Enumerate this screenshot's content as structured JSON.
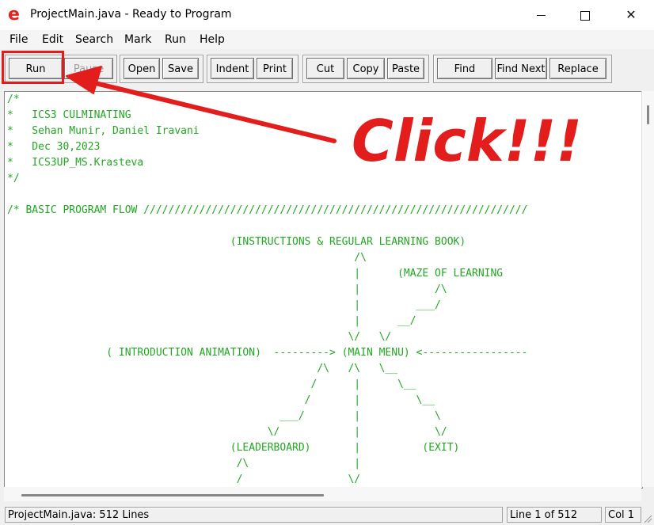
{
  "window": {
    "title": "ProjectMain.java - Ready to Program",
    "app_icon": "e",
    "controls": {
      "minimize": "minimize-icon",
      "maximize": "maximize-icon",
      "close": "✕"
    }
  },
  "menu": [
    "File",
    "Edit",
    "Search",
    "Mark",
    "Run",
    "Help"
  ],
  "toolbar": {
    "run": "Run",
    "pause": "Pause",
    "open": "Open",
    "save": "Save",
    "indent": "Indent",
    "print": "Print",
    "cut": "Cut",
    "copy": "Copy",
    "paste": "Paste",
    "find": "Find",
    "find_next": "Find Next",
    "replace": "Replace"
  },
  "annotation": {
    "text": "Click!!!",
    "color": "#e31c1c"
  },
  "code_lines": [
    "/*",
    "*   ICS3 CULMINATING",
    "*   Sehan Munir, Daniel Iravani",
    "*   Dec 30,2023",
    "*   ICS3UP_MS.Krasteva",
    "*/",
    "",
    "/* BASIC PROGRAM FLOW //////////////////////////////////////////////////////////////",
    "",
    "                                    (INSTRUCTIONS & REGULAR LEARNING BOOK)",
    "                                                        /\\",
    "                                                        |      (MAZE OF LEARNING",
    "                                                        |            /\\",
    "                                                        |         ___/",
    "                                                        |      __/",
    "                                                       \\/   \\/",
    "                ( INTRODUCTION ANIMATION)  ---------> (MAIN MENU) <-----------------",
    "                                                  /\\   /\\   \\__",
    "                                                 /      |      \\__",
    "                                                /       |         \\__",
    "                                            ___/        |            \\",
    "                                          \\/            |            \\/",
    "                                    (LEADERBOARD)       |          (EXIT)",
    "                                     /\\                 |",
    "                                     /                 \\/"
  ],
  "status": {
    "file": "ProjectMain.java: 512 Lines",
    "line": "Line 1 of 512",
    "col": "Col 1"
  },
  "colors": {
    "code": "#22a722",
    "annotation": "#e31c1c",
    "icon": "#e8221b"
  }
}
